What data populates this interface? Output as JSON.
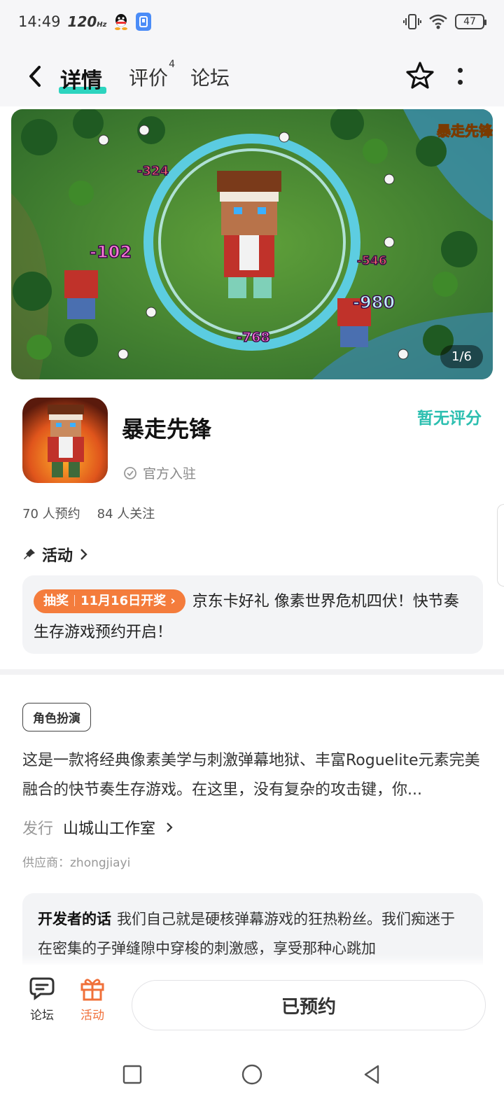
{
  "status_bar": {
    "time": "14:49",
    "refresh_rate": "120",
    "refresh_unit": "Hz",
    "battery": "47"
  },
  "nav": {
    "tabs": [
      {
        "label": "详情",
        "active": true
      },
      {
        "label": "评价",
        "badge": "4"
      },
      {
        "label": "论坛"
      }
    ]
  },
  "banner": {
    "counter": "1/6",
    "logo_text": "暴走先锋",
    "damage_numbers": [
      "-324",
      "-102",
      "-546",
      "-980",
      "-768"
    ]
  },
  "app": {
    "name": "暴走先锋",
    "official_label": "官方入驻",
    "rating_text": "暂无评分",
    "reservations": "70 人预约",
    "followers": "84 人关注"
  },
  "activity": {
    "heading": "活动",
    "tag_type": "抽奖",
    "tag_date": "11月16日开奖",
    "text": "京东卡好礼 像素世界危机四伏！快节奏生存游戏预约开启！"
  },
  "details": {
    "genre": "角色扮演",
    "description": "这是一款将经典像素美学与刺激弹幕地狱、丰富Roguelite元素完美融合的快节奏生存游戏。在这里，没有复杂的攻击键，你...",
    "publisher_label": "发行",
    "publisher_name": "山城山工作室",
    "supplier": "供应商：zhongjiayi"
  },
  "developer_note": {
    "label": "开发者的话",
    "text": "我们自己就是硬核弹幕游戏的狂热粉丝。我们痴迷于在密集的子弹缝隙中穿梭的刺激感，享受那种心跳加"
  },
  "bottom_bar": {
    "forum_label": "论坛",
    "activity_label": "活动",
    "reserved_label": "已预约"
  },
  "colors": {
    "accent": "#2dd4bf",
    "rating": "#2cbfb0",
    "orange": "#f47c3c"
  }
}
